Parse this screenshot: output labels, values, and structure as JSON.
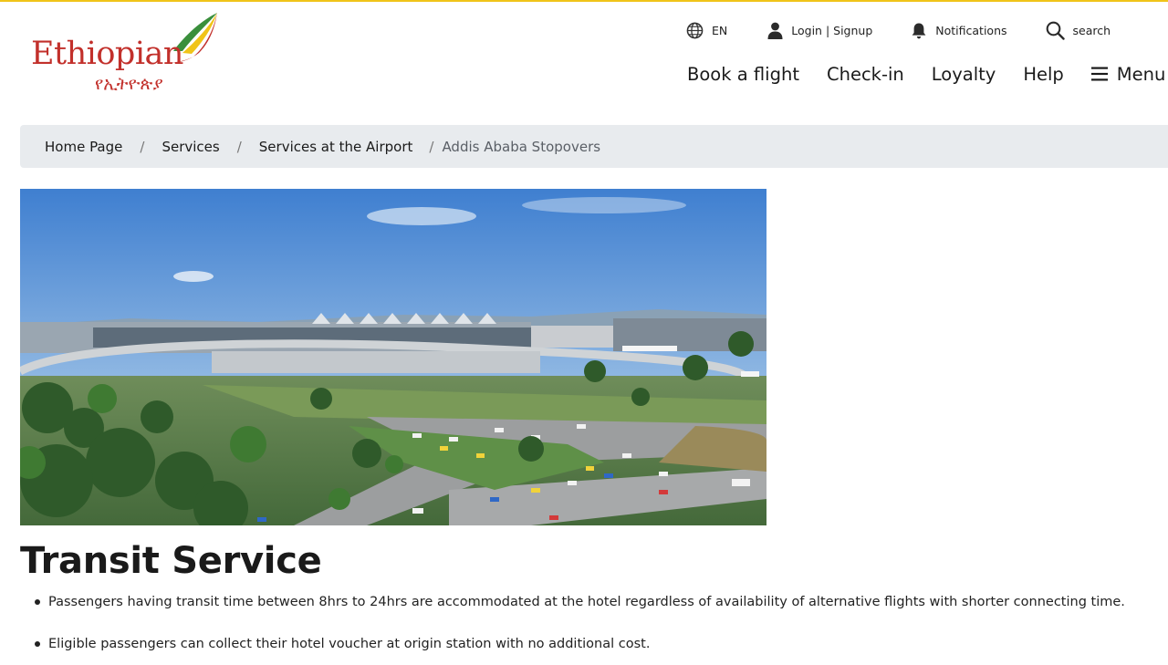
{
  "colors": {
    "brand_red": "#c2302b",
    "brand_green": "#3a8f3c",
    "brand_yellow": "#f0c419",
    "breadcrumb_bg": "#e8ebee"
  },
  "logo": {
    "name_latin": "Ethiopian",
    "name_amharic": "የኢትዮጵያ"
  },
  "utility": {
    "language": {
      "icon": "globe-icon",
      "label": "EN"
    },
    "account": {
      "icon": "user-icon",
      "label": "Login | Signup"
    },
    "notifications": {
      "icon": "bell-icon",
      "label": "Notifications"
    },
    "search": {
      "icon": "search-icon",
      "label": "search"
    }
  },
  "nav": {
    "items": [
      "Book a flight",
      "Check-in",
      "Loyalty",
      "Help"
    ],
    "menu": {
      "icon": "hamburger-icon",
      "label": "Menu"
    }
  },
  "breadcrumb": {
    "items": [
      "Home Page",
      "Services",
      "Services at the Airport",
      "Addis Ababa Stopovers"
    ],
    "separator": "/"
  },
  "hero": {
    "subject": "airport-terminal-photo"
  },
  "content": {
    "title": "Transit Service",
    "bullets": [
      "Passengers having transit time between 8hrs to 24hrs are accommodated at the hotel regardless of availability of alternative flights with shorter connecting time.",
      "Eligible passengers can collect their hotel voucher at origin station with no additional cost."
    ]
  }
}
